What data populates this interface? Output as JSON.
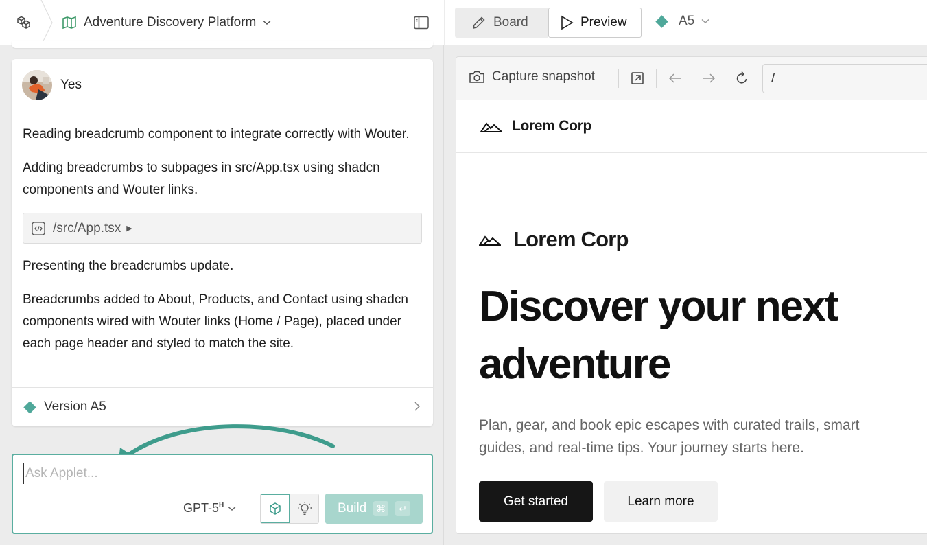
{
  "header": {
    "project_title": "Adventure Discovery Platform"
  },
  "chat": {
    "user_message": "Yes",
    "paragraphs": [
      "Reading breadcrumb component to integrate correctly with Wouter.",
      "Adding breadcrumbs to subpages in src/App.tsx using shadcn components and Wouter links.",
      "Presenting the breadcrumbs update.",
      "Breadcrumbs added to About, Products, and Contact using shadcn components wired with Wouter links (Home / Page), placed under each page header and styled to match the site."
    ],
    "file_chip": "/src/App.tsx",
    "version_label": "Version A5"
  },
  "composer": {
    "placeholder": "Ask Applet...",
    "model": "GPT-5",
    "model_sup": "H",
    "build_label": "Build",
    "kbd_cmd": "⌘",
    "kbd_enter": "↵"
  },
  "view_tabs": {
    "board": "Board",
    "preview": "Preview",
    "version": "A5"
  },
  "browser": {
    "snapshot_label": "Capture snapshot",
    "url": "/"
  },
  "site": {
    "brand": "Lorem Corp",
    "hero_title": "Discover your next adventure",
    "hero_subtitle": "Plan, gear, and book epic escapes with curated trails, smart guides, and real-time tips. Your journey starts here.",
    "cta_primary": "Get started",
    "cta_secondary": "Learn more"
  },
  "colors": {
    "accent": "#4fa89a",
    "build_disabled": "#a8d6cd",
    "cta_dark": "#161616"
  }
}
